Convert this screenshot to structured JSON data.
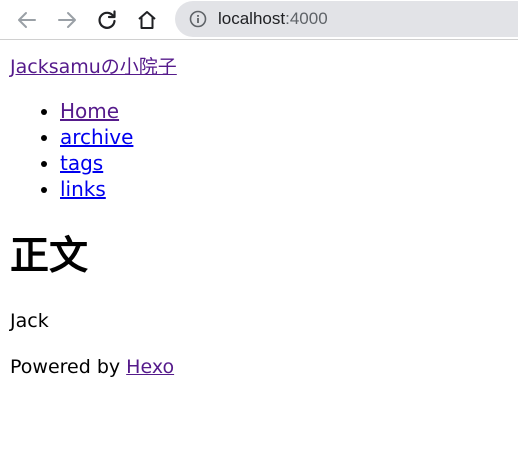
{
  "browser": {
    "url_host": "localhost",
    "url_port": ":4000",
    "icons": [
      "back-arrow-icon",
      "forward-arrow-icon",
      "reload-icon",
      "home-icon",
      "info-icon"
    ]
  },
  "site": {
    "title": "Jacksamuの小院子"
  },
  "menu": {
    "items": [
      {
        "label": "Home"
      },
      {
        "label": "archive"
      },
      {
        "label": "tags"
      },
      {
        "label": "links"
      }
    ]
  },
  "post": {
    "title": "正文",
    "body": "Jack"
  },
  "footer": {
    "prefix": "Powered by ",
    "link": "Hexo"
  },
  "colors": {
    "visited_link": "#551a8b",
    "unvisited_link": "#0000ee",
    "omnibox_bg": "#e2e3e7"
  }
}
